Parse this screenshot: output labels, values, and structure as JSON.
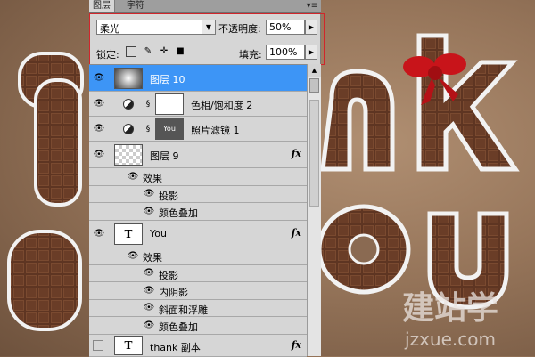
{
  "tabs": [
    {
      "label": "图层"
    },
    {
      "label": "字符"
    }
  ],
  "panel_menu": "▾≡",
  "blend_mode": "柔光",
  "opacity": {
    "label": "不透明度:",
    "value": "50%"
  },
  "lock": {
    "label": "锁定:"
  },
  "fill": {
    "label": "填充:",
    "value": "100%"
  },
  "layers": [
    {
      "name": "图层 10",
      "selected": true
    },
    {
      "name": "色相/饱和度 2"
    },
    {
      "name": "照片滤镜 1",
      "thumb_text": "You"
    },
    {
      "name": "图层 9",
      "fx": "fx"
    },
    {
      "name": "效果"
    },
    {
      "name": "投影"
    },
    {
      "name": "颜色叠加"
    },
    {
      "name": "You",
      "thumb_text": "T",
      "fx": "fx"
    },
    {
      "name": "效果"
    },
    {
      "name": "投影"
    },
    {
      "name": "内阴影"
    },
    {
      "name": "斜面和浮雕"
    },
    {
      "name": "颜色叠加"
    },
    {
      "name": "thank 副本",
      "thumb_text": "T",
      "fx": "fx"
    }
  ],
  "watermark": {
    "title": "建站学",
    "url": "jzxue.com"
  },
  "colors": {
    "selected": "#3d95f6",
    "highlight_box": "#d0262c",
    "chocolate": "#5a3220"
  }
}
